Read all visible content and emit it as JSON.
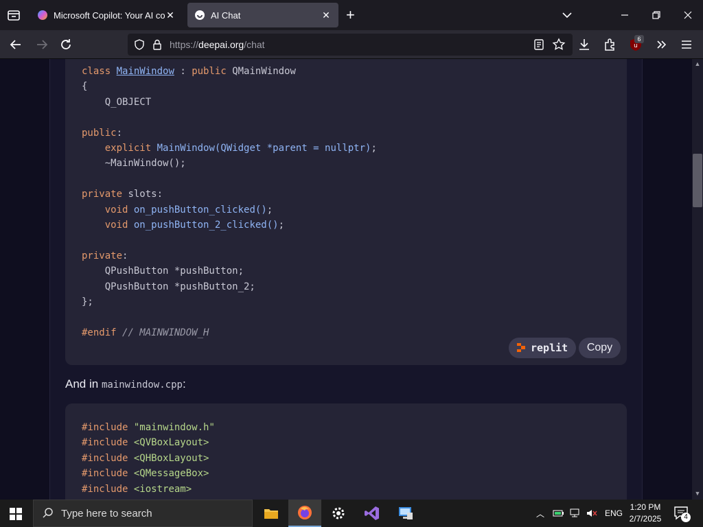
{
  "browser": {
    "tabs": [
      {
        "title": "Microsoft Copilot: Your AI comp",
        "active": false
      },
      {
        "title": "AI Chat",
        "active": true
      }
    ],
    "url_prefix": "https://",
    "url_host": "deepai.org",
    "url_path": "/chat",
    "extension_badge": "6"
  },
  "page": {
    "code_block_1": {
      "replit_label": "replit",
      "copy_label": "Copy"
    },
    "prose_before": "And in ",
    "prose_code": "mainwindow.cpp",
    "prose_after": ":"
  },
  "taskbar": {
    "search_placeholder": "Type here to search",
    "language": "ENG",
    "time": "1:20 PM",
    "date": "2/7/2025",
    "notification_count": "4"
  },
  "colors": {
    "keyword": "#e59a6c",
    "function": "#8fb4f4",
    "string": "#b6d78a",
    "code_bg": "#252436",
    "page_bg": "#0f0e1f"
  }
}
